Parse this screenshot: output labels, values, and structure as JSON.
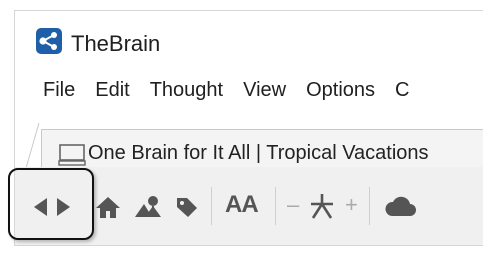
{
  "app": {
    "title": "TheBrain"
  },
  "menu": {
    "items": [
      "File",
      "Edit",
      "Thought",
      "View",
      "Options",
      "C"
    ]
  },
  "tabs": [
    {
      "label": "One Brain for It All | Tropical Vacations",
      "icon": "computer-icon"
    }
  ],
  "toolbar": {
    "font_size_label": "AA",
    "zoom_out_label": "–",
    "zoom_in_label": "+",
    "icons": [
      "back-arrow-icon",
      "forward-arrow-icon",
      "home-icon",
      "pinned-thoughts-icon",
      "tag-icon",
      "font-size-icon",
      "zoom-out-icon",
      "plex-layout-icon",
      "zoom-in-icon",
      "cloud-sync-icon"
    ]
  },
  "colors": {
    "logo_blue": "#1f5fa8",
    "icon_gray": "#555555",
    "separator": "#cfcfcf",
    "highlight_border": "#111111"
  }
}
